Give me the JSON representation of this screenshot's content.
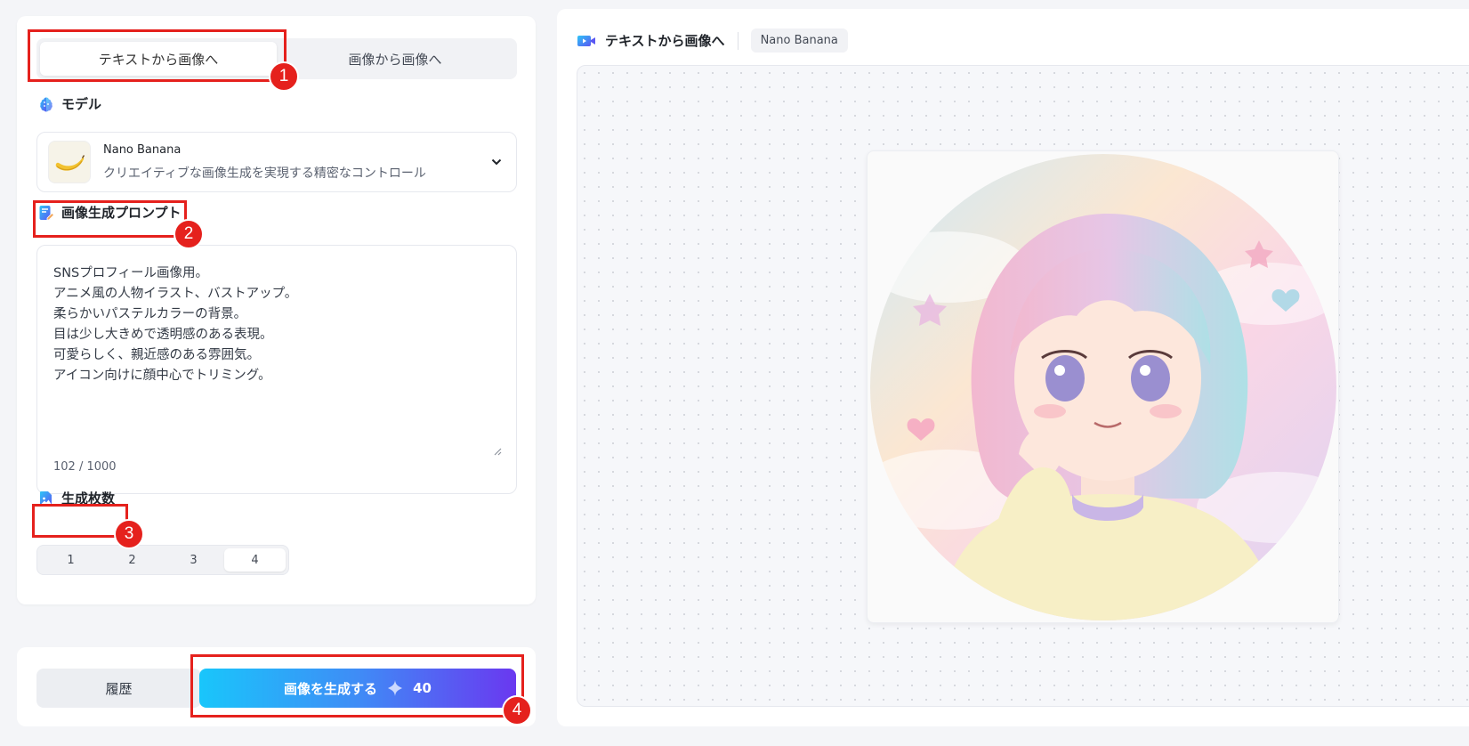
{
  "left": {
    "tabs": [
      {
        "label": "テキストから画像へ",
        "active": true
      },
      {
        "label": "画像から画像へ",
        "active": false
      }
    ],
    "model_section": {
      "label": "モデル",
      "selected_name": "Nano Banana",
      "selected_desc": "クリエイティブな画像生成を実現する精密なコントロール",
      "thumb_icon": "banana-icon"
    },
    "prompt_section": {
      "label": "画像生成プロンプト",
      "value": "SNSプロフィール画像用。\nアニメ風の人物イラスト、バストアップ。\n柔らかいパステルカラーの背景。\n目は少し大きめで透明感のある表現。\n可愛らしく、親近感のある雰囲気。\nアイコン向けに顔中心でトリミング。",
      "counter": "102 / 1000"
    },
    "count_section": {
      "label": "生成枚数",
      "options": [
        "1",
        "2",
        "3",
        "4"
      ],
      "selected": "4"
    }
  },
  "bottom": {
    "history_label": "履歴",
    "generate_label": "画像を生成する",
    "generate_cost": "40"
  },
  "annotations": [
    "1",
    "2",
    "3",
    "4"
  ],
  "right": {
    "title": "テキストから画像へ",
    "model_tag": "Nano Banana"
  },
  "colors": {
    "accent_start": "#19c6fb",
    "accent_end": "#6a38f0",
    "annotation_red": "#e5211d"
  }
}
